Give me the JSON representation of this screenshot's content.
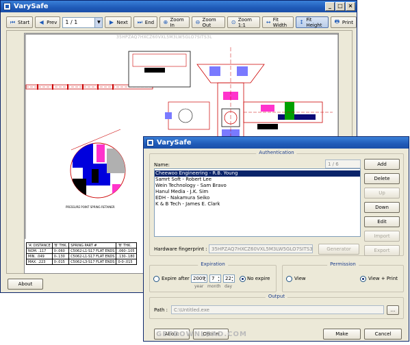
{
  "main_window": {
    "title": "VarySafe",
    "toolbar": {
      "start": "Start",
      "prev": "Prev",
      "page": "1 / 1",
      "next": "Next",
      "end": "End",
      "zoom_in": "Zoom In",
      "zoom_out": "Zoom Out",
      "zoom_1": "Zoom 1:1",
      "fit_width": "Fit Width",
      "fit_height": "Fit Height",
      "print": "Print"
    },
    "fingerprint_overlay": "35HPZAQ7HXCZ60VXL5M3LW5GLO7SITS3L",
    "spec_table": {
      "headers": [
        "'A' DISTANCE",
        "'B' THK.",
        "SPRING PART #",
        "'B' THK."
      ],
      "rows": [
        [
          "NOM. .117",
          "0-.060",
          "C5062-L1-S17 FLAT ENDS",
          ".060-.105"
        ],
        [
          "MIN. .049",
          "0-.130",
          "C5062-L1-S17 FLAT ENDS",
          ".130-.180"
        ],
        [
          "MAX. .223",
          "0-.015",
          "C5062-L3-S17 FLAT ENDS",
          "0-0-.015"
        ]
      ]
    },
    "about": "About"
  },
  "dialog": {
    "title": "VarySafe",
    "authentication": {
      "legend": "Authentication",
      "name_label": "Name:",
      "counter": "1 / 6",
      "names": [
        "Cheewoo Engineering - R.B. Young",
        "Samrt Soft - Robert Lee",
        "Wein Technology - Sam Bravo",
        "Hanul Media - J.K. Sim",
        "EDH - Nakamura Seiko",
        "K & B Tech - James E. Clark"
      ],
      "selected_index": 0,
      "buttons": {
        "add": "Add",
        "delete": "Delete",
        "up": "Up",
        "down": "Down",
        "edit": "Edit",
        "import": "Import",
        "export": "Export"
      },
      "hw_label": "Hardware fingerprint :",
      "hw_value": "35HPZAQ7HXCZ60VXL5M3LW5GLO7SITS3L",
      "generator": "Generator"
    },
    "expiration": {
      "legend": "Expiration",
      "expire_after": "Expire after",
      "year": "2009",
      "month": "7",
      "day": "22",
      "year_cap": "year",
      "month_cap": "month",
      "day_cap": "day",
      "no_expire": "No expire",
      "selected": "No expire"
    },
    "permission": {
      "legend": "Permission",
      "view": "View",
      "view_print": "View + Print",
      "selected": "View + Print"
    },
    "output": {
      "legend": "Output",
      "path_label": "Path :",
      "path_value": "C:\\Untitled.exe",
      "browse": "..."
    },
    "footer": {
      "about": "About",
      "option": "Option",
      "make": "Make",
      "cancel": "Cancel"
    }
  },
  "watermark": "GETDOWNLOAD.COM"
}
